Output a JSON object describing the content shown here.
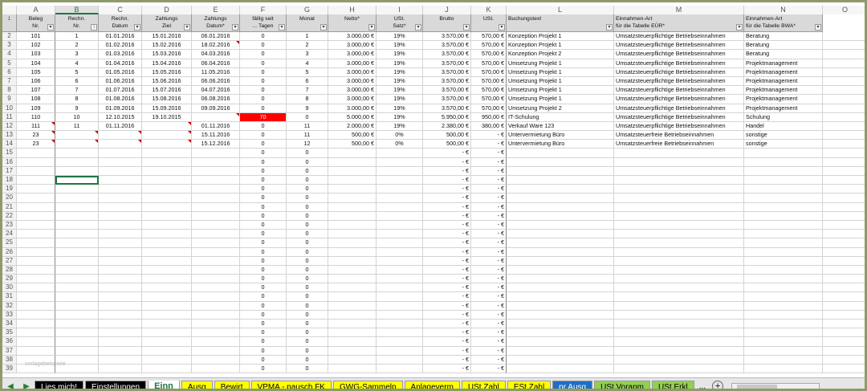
{
  "columns": [
    "A",
    "B",
    "C",
    "D",
    "E",
    "F",
    "G",
    "H",
    "I",
    "J",
    "K",
    "L",
    "M",
    "N",
    "O"
  ],
  "headers": [
    {
      "l1": "Beleg",
      "l2": "Nr."
    },
    {
      "l1": "Rechn.",
      "l2": "Nr."
    },
    {
      "l1": "Rechn.",
      "l2": "Datum"
    },
    {
      "l1": "Zahlungs",
      "l2": "Ziel"
    },
    {
      "l1": "Zahlungs",
      "l2": "Datum*"
    },
    {
      "l1": "fällig seit",
      "l2": "... Tagen"
    },
    {
      "l1": "",
      "l2": "Monat"
    },
    {
      "l1": "",
      "l2": "Netto*"
    },
    {
      "l1": "USt.",
      "l2": "Satz*"
    },
    {
      "l1": "",
      "l2": "Brutto"
    },
    {
      "l1": "",
      "l2": "USt."
    },
    {
      "l1": "",
      "l2": "Buchungstext"
    },
    {
      "l1": "Einnahmen-Art",
      "l2": "für die Tabelle EÜR*"
    },
    {
      "l1": "Einnahmen-Art",
      "l2": "für die Tabelle BWA*"
    },
    {
      "l1": "",
      "l2": ""
    }
  ],
  "rows": [
    [
      "101",
      "1",
      "01.01.2016",
      "15.01.2016",
      "06.01.2016",
      "0",
      "1",
      "3.000,00 €",
      "19%",
      "3.570,00 €",
      "570,00 €",
      "Konzeption Projekt 1",
      "Umsatzsteuerpflichtige Betriebseinnahmen",
      "Beratung"
    ],
    [
      "102",
      "2",
      "01.02.2016",
      "15.02.2016",
      "18.02.2016",
      "0",
      "2",
      "3.000,00 €",
      "19%",
      "3.570,00 €",
      "570,00 €",
      "Konzeption Projekt 1",
      "Umsatzsteuerpflichtige Betriebseinnahmen",
      "Beratung"
    ],
    [
      "103",
      "3",
      "01.03.2016",
      "15.03.2016",
      "04.03.2016",
      "0",
      "3",
      "3.000,00 €",
      "19%",
      "3.570,00 €",
      "570,00 €",
      "Konzeption Projekt 2",
      "Umsatzsteuerpflichtige Betriebseinnahmen",
      "Beratung"
    ],
    [
      "104",
      "4",
      "01.04.2016",
      "15.04.2016",
      "06.04.2016",
      "0",
      "4",
      "3.000,00 €",
      "19%",
      "3.570,00 €",
      "570,00 €",
      "Umsetzung Projekt 1",
      "Umsatzsteuerpflichtige Betriebseinnahmen",
      "Projektmanagement"
    ],
    [
      "105",
      "5",
      "01.05.2016",
      "15.05.2016",
      "11.05.2016",
      "0",
      "5",
      "3.000,00 €",
      "19%",
      "3.570,00 €",
      "570,00 €",
      "Umsetzung Projekt 1",
      "Umsatzsteuerpflichtige Betriebseinnahmen",
      "Projektmanagement"
    ],
    [
      "106",
      "6",
      "01.06.2016",
      "15.06.2016",
      "06.06.2016",
      "0",
      "6",
      "3.000,00 €",
      "19%",
      "3.570,00 €",
      "570,00 €",
      "Umsetzung Projekt 1",
      "Umsatzsteuerpflichtige Betriebseinnahmen",
      "Projektmanagement"
    ],
    [
      "107",
      "7",
      "01.07.2016",
      "15.07.2016",
      "04.07.2016",
      "0",
      "7",
      "3.000,00 €",
      "19%",
      "3.570,00 €",
      "570,00 €",
      "Umsetzung Projekt 1",
      "Umsatzsteuerpflichtige Betriebseinnahmen",
      "Projektmanagement"
    ],
    [
      "108",
      "8",
      "01.08.2016",
      "15.08.2016",
      "06.08.2016",
      "0",
      "8",
      "3.000,00 €",
      "19%",
      "3.570,00 €",
      "570,00 €",
      "Umsetzung Projekt 1",
      "Umsatzsteuerpflichtige Betriebseinnahmen",
      "Projektmanagement"
    ],
    [
      "109",
      "9",
      "01.09.2016",
      "15.09.2016",
      "09.09.2016",
      "0",
      "9",
      "3.000,00 €",
      "19%",
      "3.570,00 €",
      "570,00 €",
      "Umsetzung Projekt 2",
      "Umsatzsteuerpflichtige Betriebseinnahmen",
      "Projektmanagement"
    ],
    [
      "110",
      "10",
      "12.10.2015",
      "19.10.2015",
      "",
      "70",
      "0",
      "5.000,00 €",
      "19%",
      "5.950,00 €",
      "950,00 €",
      "IT-Schulung",
      "Umsatzsteuerpflichtige Betriebseinnahmen",
      "Schulung"
    ],
    [
      "111",
      "11",
      "01.11.2016",
      "",
      "01.11.2016",
      "0",
      "11",
      "2.000,00 €",
      "19%",
      "2.380,00 €",
      "380,00 €",
      "Verkauf Ware 123",
      "Umsatzsteuerpflichtige Betriebseinnahmen",
      "Handel"
    ],
    [
      "23",
      "",
      "",
      "",
      "15.11.2016",
      "0",
      "11",
      "500,00 €",
      "0%",
      "500,00 €",
      "-   €",
      "Untervermietung Büro",
      "Umsatzsteuerfreie Betriebseinnahmen",
      "sonstige"
    ],
    [
      "23",
      "",
      "",
      "",
      "15.12.2016",
      "0",
      "12",
      "500,00 €",
      "0%",
      "500,00 €",
      "-   €",
      "Untervermietung Büro",
      "Umsatzsteuerfreie Betriebseinnahmen",
      "sonstige"
    ]
  ],
  "empty_row": {
    "f": "0",
    "g": "0",
    "j": "-   €",
    "k": "-   €"
  },
  "total_rows": 39,
  "watermark": "vorlagebeispiele",
  "tabs": [
    {
      "label": "Lies mich!",
      "bg": "#000000",
      "fg": "#ffffff"
    },
    {
      "label": "Einstellungen",
      "bg": "#000000",
      "fg": "#ffffff"
    },
    {
      "label": "Einn",
      "bg": "#ffffff",
      "fg": "#217346",
      "active": true
    },
    {
      "label": "Ausg",
      "bg": "#ffff00",
      "fg": "#000000"
    },
    {
      "label": "Bewirt",
      "bg": "#ffff00",
      "fg": "#000000"
    },
    {
      "label": "VPMA - pausch.FK",
      "bg": "#ffff00",
      "fg": "#000000"
    },
    {
      "label": "GWG-Sammelp",
      "bg": "#ffff00",
      "fg": "#000000"
    },
    {
      "label": "Anlageverm",
      "bg": "#ffff00",
      "fg": "#000000"
    },
    {
      "label": "USt.Zahl",
      "bg": "#ffff00",
      "fg": "#000000"
    },
    {
      "label": "ESt.Zahl",
      "bg": "#ffff00",
      "fg": "#000000"
    },
    {
      "label": "pr.Ausg",
      "bg": "#1f6fc4",
      "fg": "#ffffff"
    },
    {
      "label": "USt.Voranm",
      "bg": "#92d050",
      "fg": "#000000"
    },
    {
      "label": "USt.Erkl",
      "bg": "#92d050",
      "fg": "#000000"
    }
  ],
  "more_tabs": "...",
  "add_sheet": "+"
}
